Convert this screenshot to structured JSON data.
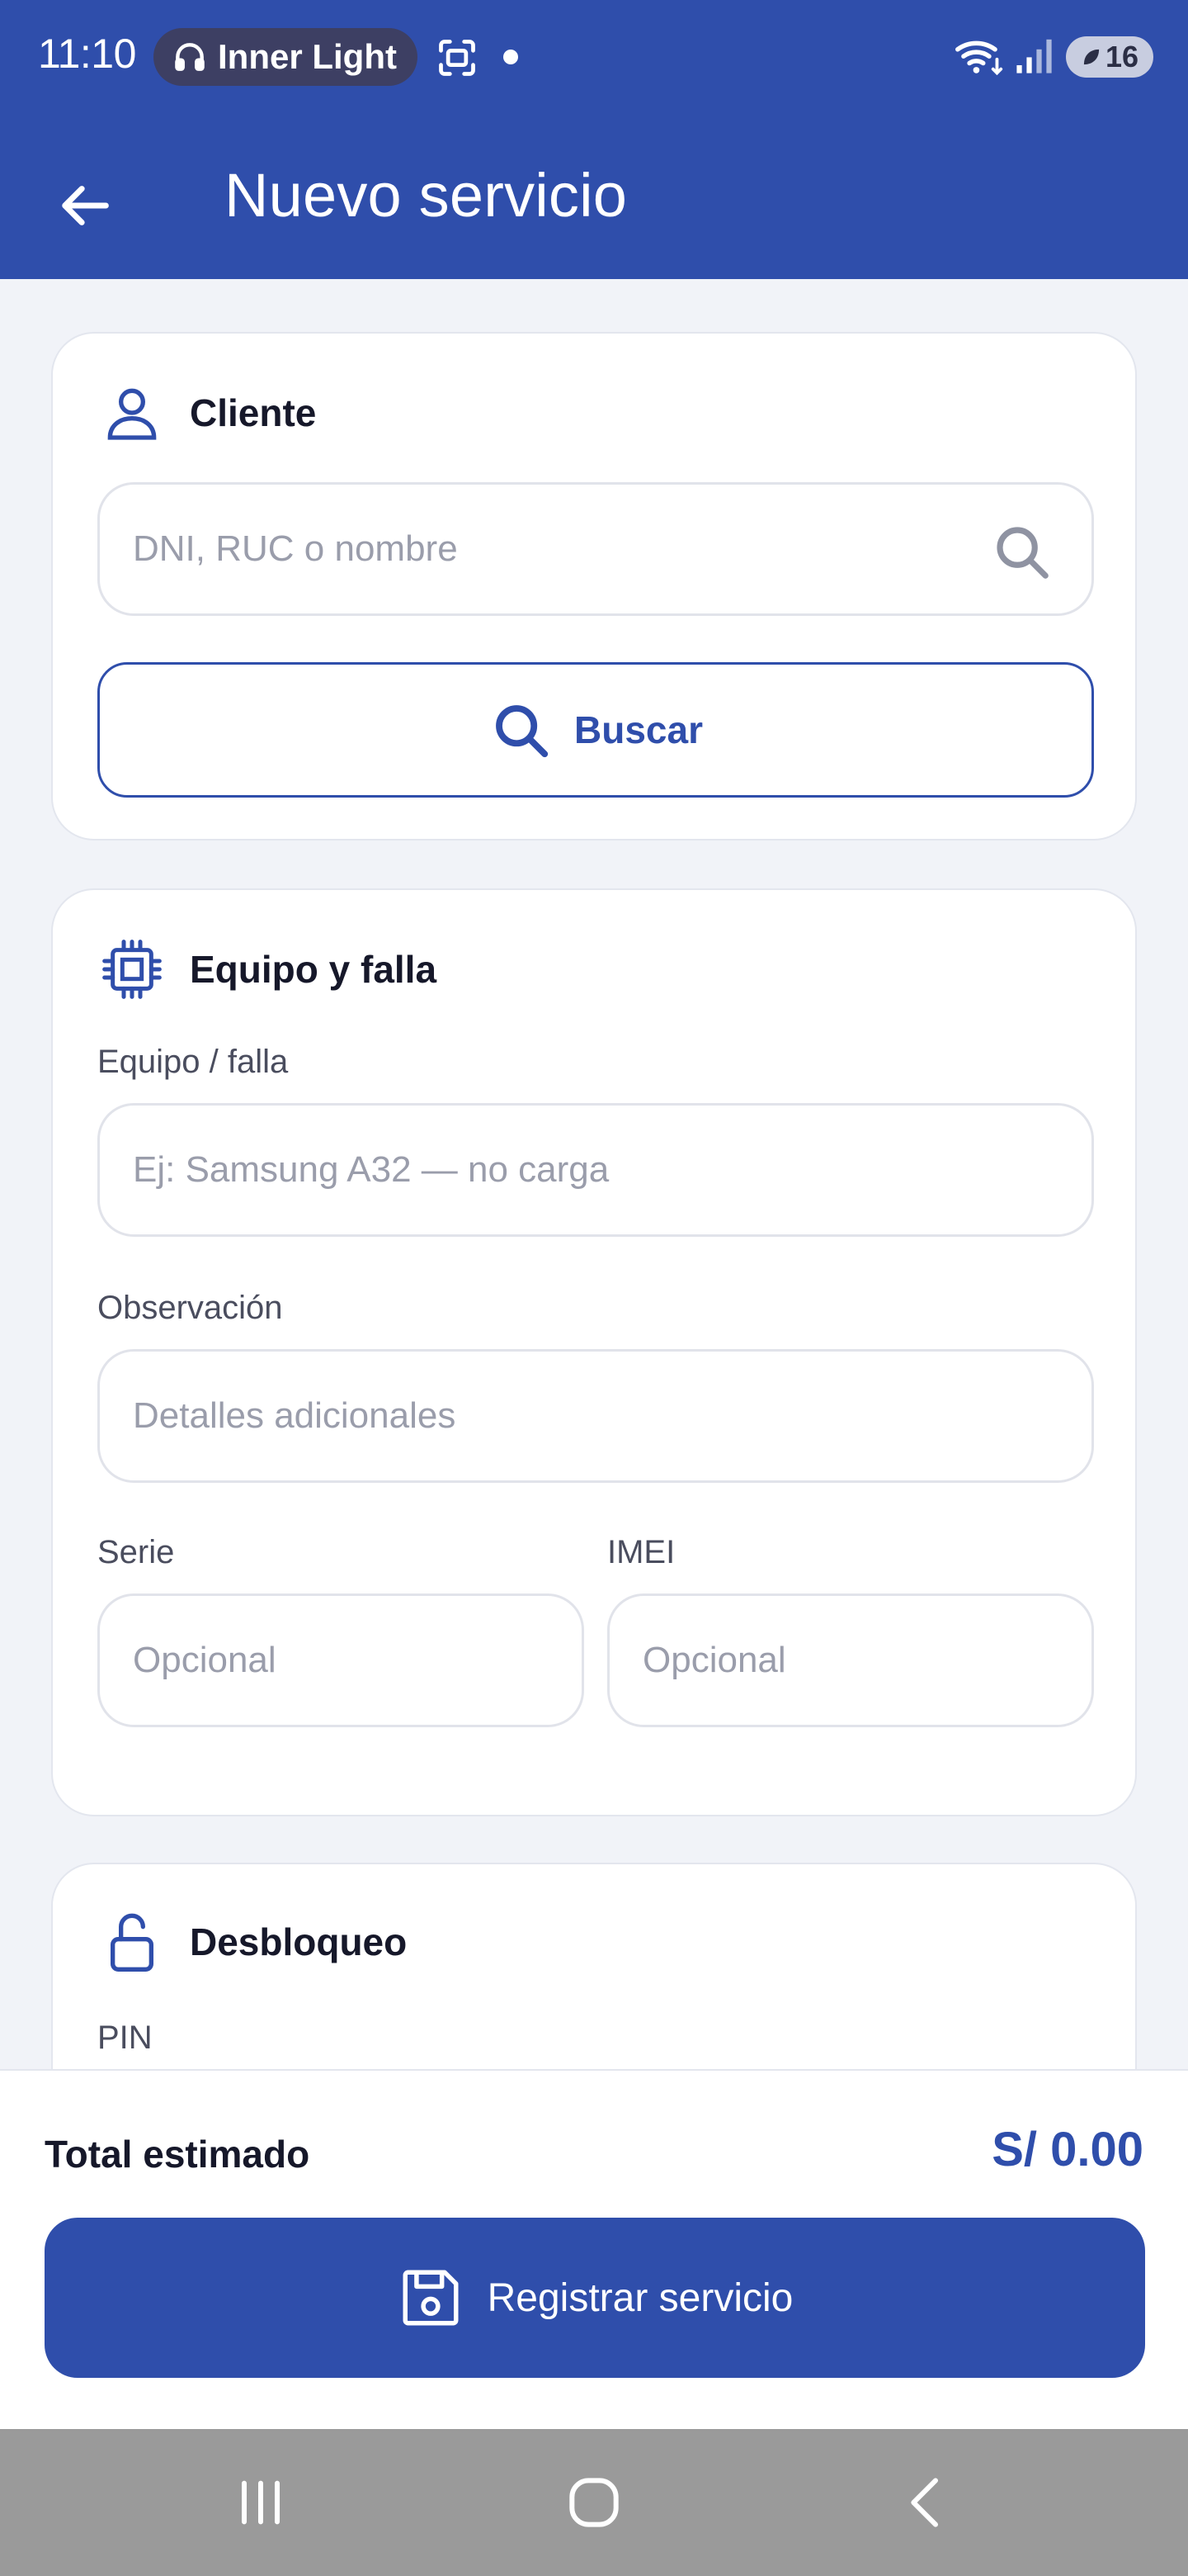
{
  "status_bar": {
    "time": "11:10",
    "media_app": "Inner Light",
    "battery": "16"
  },
  "app_bar": {
    "title": "Nuevo servicio"
  },
  "cliente": {
    "title": "Cliente",
    "search_placeholder": "DNI, RUC o nombre",
    "search_value": "",
    "button_label": "Buscar"
  },
  "equipo": {
    "title": "Equipo y falla",
    "equipo_label": "Equipo / falla",
    "equipo_placeholder": "Ej: Samsung A32 — no carga",
    "observacion_label": "Observación",
    "observacion_placeholder": "Detalles adicionales",
    "serie_label": "Serie",
    "serie_placeholder": "Opcional",
    "imei_label": "IMEI",
    "imei_placeholder": "Opcional"
  },
  "desbloqueo": {
    "title": "Desbloqueo",
    "pin_label": "PIN"
  },
  "footer": {
    "total_label": "Total estimado",
    "total_value": "S/ 0.00",
    "submit_label": "Registrar servicio"
  },
  "colors": {
    "primary": "#2f4eab",
    "background": "#f1f3f8",
    "card": "#ffffff",
    "navbar": "#9a9a9a"
  },
  "icons": {
    "back": "arrow-left-icon",
    "cliente": "person-icon",
    "search": "search-icon",
    "equipo": "chip-icon",
    "desbloqueo": "unlock-icon",
    "submit": "save-icon"
  }
}
